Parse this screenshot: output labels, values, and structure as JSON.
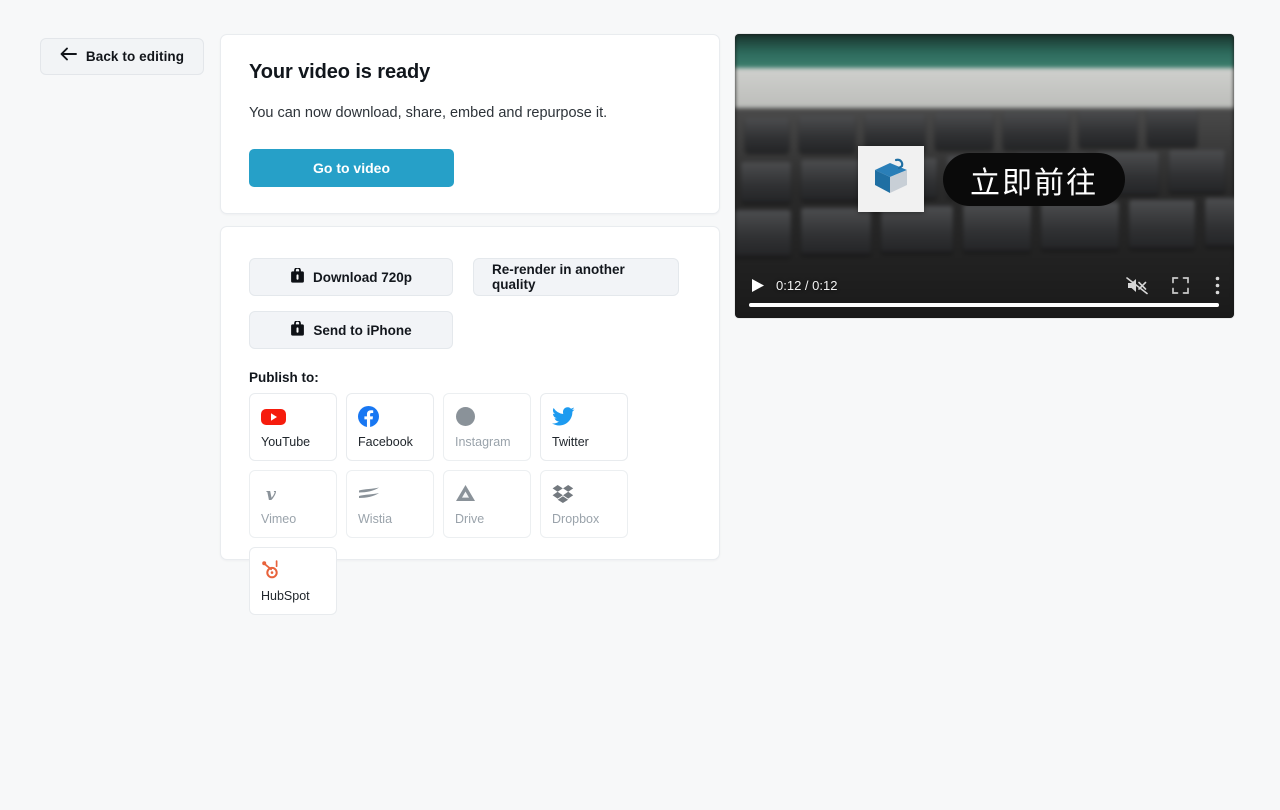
{
  "back_button": {
    "label": "Back to editing",
    "icon": "arrow-left-icon"
  },
  "ready_card": {
    "title": "Your video is ready",
    "subtitle": "You can now download, share, embed and repurpose it.",
    "primary_button": "Go to video",
    "primary_color": "#26a0c8"
  },
  "actions_card": {
    "download_button": {
      "label": "Download 720p",
      "icon": "download-box-icon"
    },
    "rerender_button": {
      "label": "Re-render in another quality"
    },
    "iphone_button": {
      "label": "Send to iPhone",
      "icon": "download-box-icon"
    },
    "publish_label": "Publish to:",
    "publish_targets": [
      {
        "name": "YouTube",
        "icon": "youtube-icon",
        "enabled": true
      },
      {
        "name": "Facebook",
        "icon": "facebook-icon",
        "enabled": true
      },
      {
        "name": "Instagram",
        "icon": "instagram-icon",
        "enabled": false
      },
      {
        "name": "Twitter",
        "icon": "twitter-icon",
        "enabled": true
      },
      {
        "name": "Vimeo",
        "icon": "vimeo-icon",
        "enabled": false
      },
      {
        "name": "Wistia",
        "icon": "wistia-icon",
        "enabled": false
      },
      {
        "name": "Drive",
        "icon": "google-drive-icon",
        "enabled": false
      },
      {
        "name": "Dropbox",
        "icon": "dropbox-icon",
        "enabled": false
      },
      {
        "name": "HubSpot",
        "icon": "hubspot-icon",
        "enabled": true
      }
    ]
  },
  "video_player": {
    "current_time": "0:12",
    "duration": "0:12",
    "time_display": "0:12 / 0:12",
    "progress_percent": 100,
    "muted": true,
    "overlay_text": "立即前往",
    "overlay_icon": "package-box-icon",
    "controls": {
      "play": "play-icon",
      "mute": "volume-muted-icon",
      "fullscreen": "fullscreen-icon",
      "more": "more-vertical-icon"
    }
  }
}
